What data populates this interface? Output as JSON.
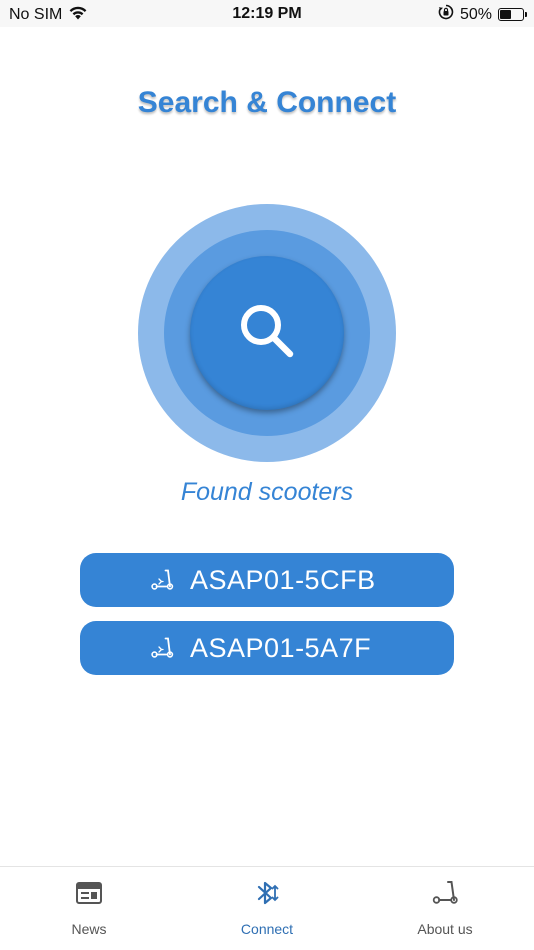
{
  "status_bar": {
    "carrier": "No SIM",
    "time": "12:19 PM",
    "battery_percent": "50%",
    "battery_level": 0.5,
    "icons": [
      "wifi-icon",
      "orientation-lock-icon",
      "battery-icon"
    ]
  },
  "title": "Search & Connect",
  "search": {
    "icon": "search-icon"
  },
  "found_label": "Found scooters",
  "devices": [
    {
      "name": "ASAP01-5CFB",
      "icon": "scooter-icon"
    },
    {
      "name": "ASAP01-5A7F",
      "icon": "scooter-icon"
    }
  ],
  "tabs": [
    {
      "label": "News",
      "icon": "newspaper-icon",
      "active": false
    },
    {
      "label": "Connect",
      "icon": "bluetooth-icon",
      "active": true
    },
    {
      "label": "About us",
      "icon": "scooter-icon",
      "active": false
    }
  ],
  "colors": {
    "accent": "#3584d5",
    "radar_outer": "#8cb9ea",
    "radar_middle": "#5a9be0",
    "tab_active": "#2f6fb3",
    "tab_inactive": "#555555"
  }
}
